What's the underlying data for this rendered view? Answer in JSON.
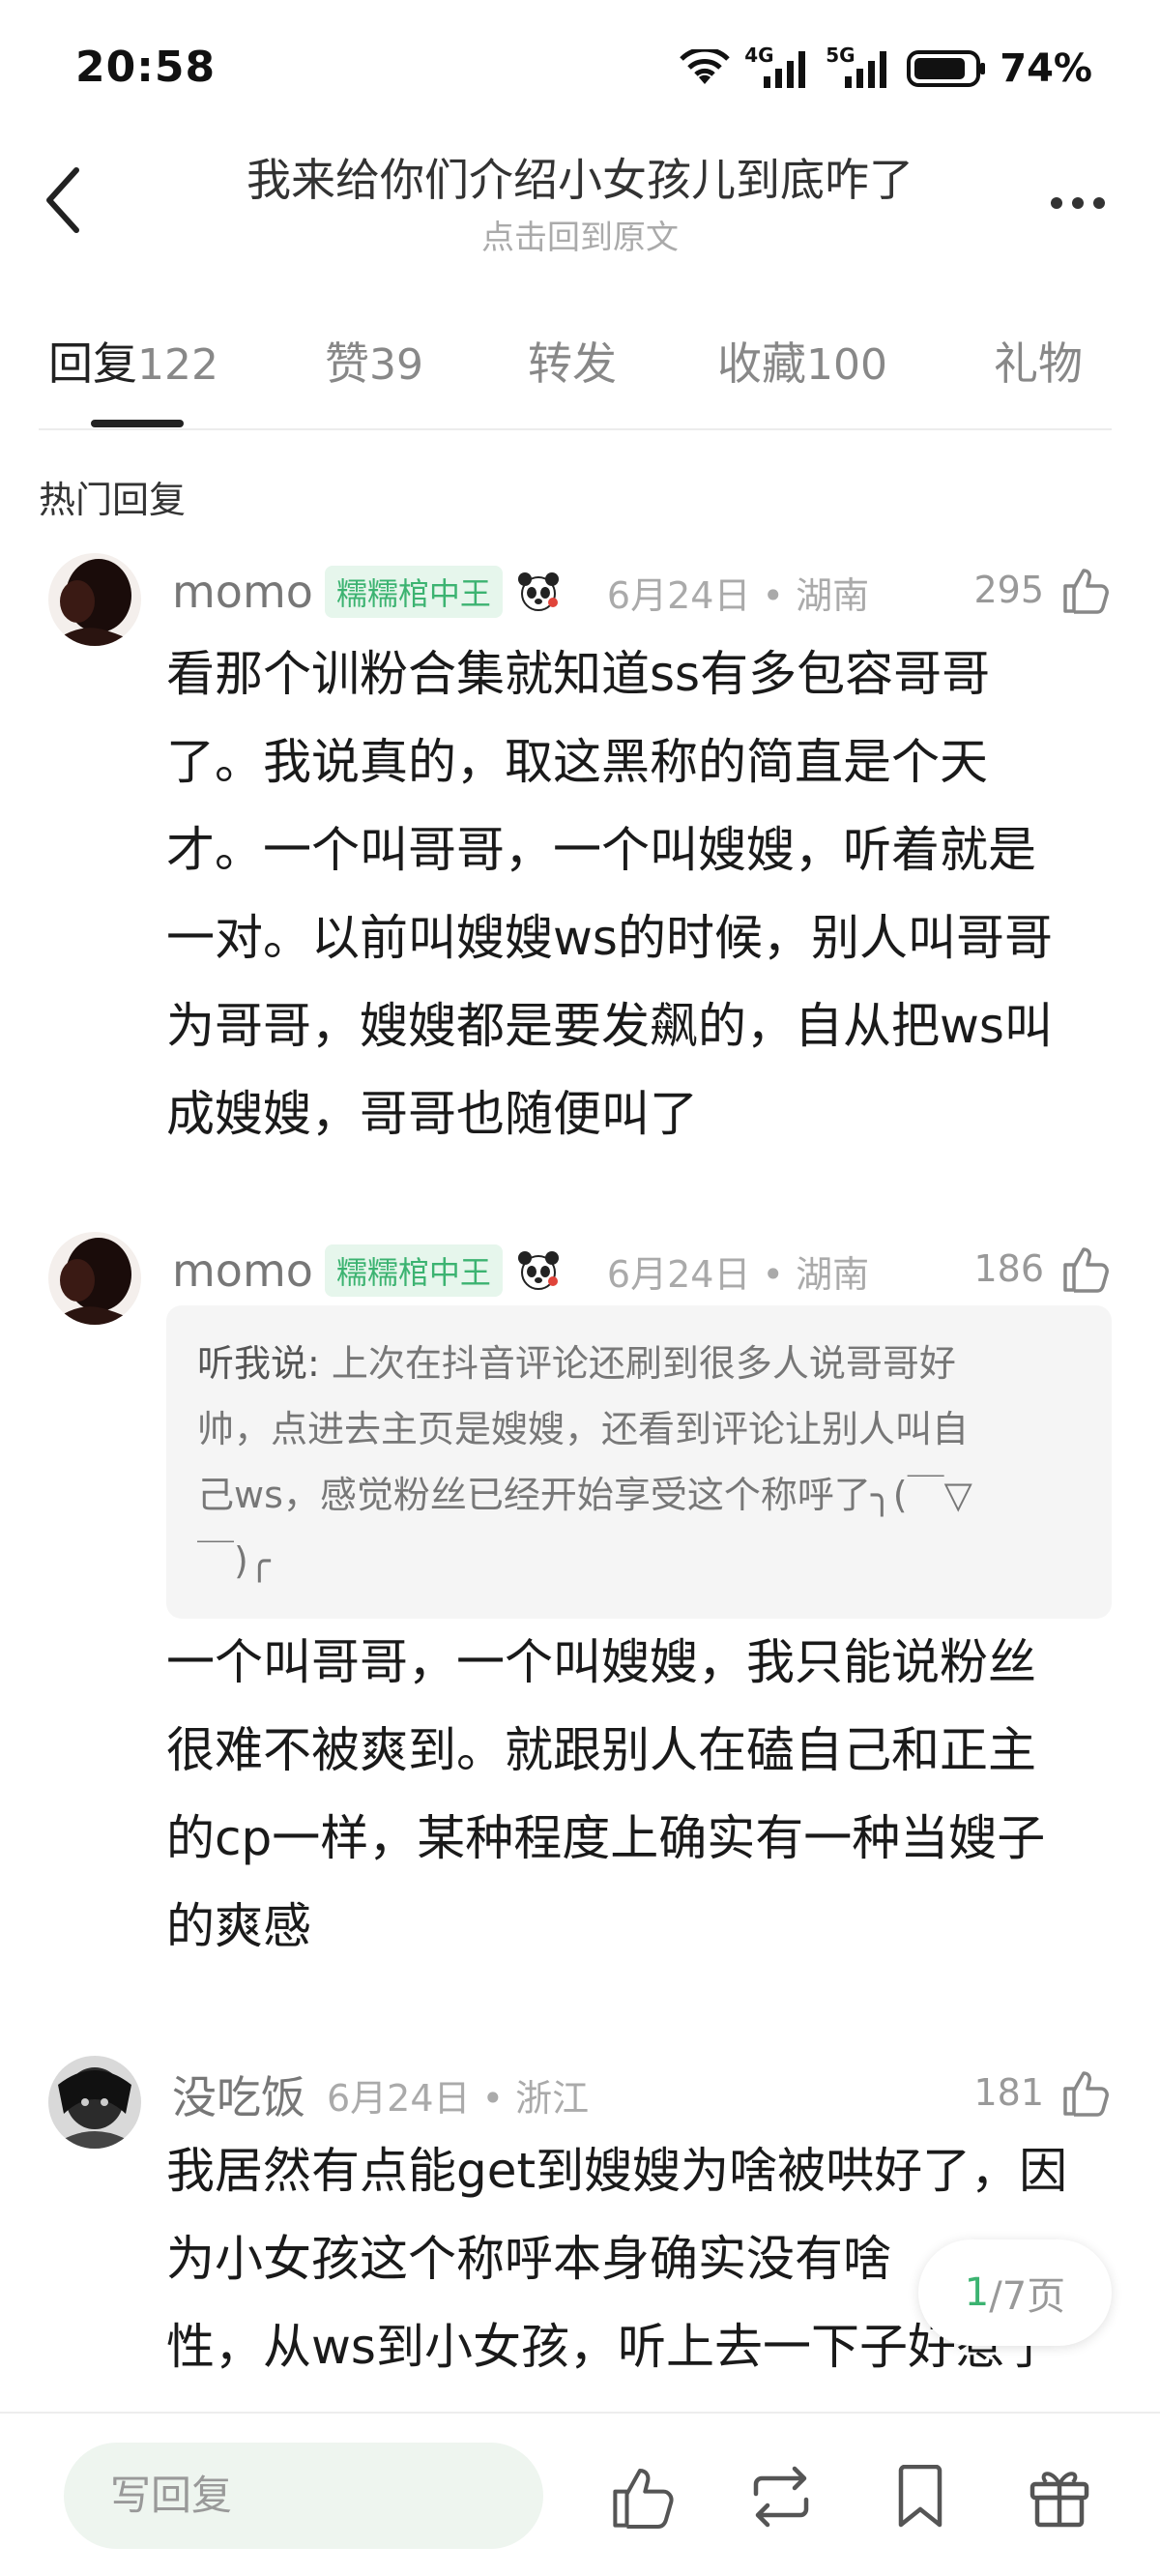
{
  "status_bar": {
    "time": "20:58",
    "net1": "4G",
    "net2": "5G",
    "battery": "74%"
  },
  "header": {
    "title": "我来给你们介绍小女孩儿到底咋了",
    "subtitle": "点击回到原文"
  },
  "tabs": [
    {
      "label": "回复",
      "count": "122"
    },
    {
      "label": "赞",
      "count": "39"
    },
    {
      "label": "转发",
      "count": ""
    },
    {
      "label": "收藏",
      "count": "100"
    },
    {
      "label": "礼物",
      "count": ""
    }
  ],
  "section_label": "热门回复",
  "posts": [
    {
      "username": "momo",
      "badge": "糯糯棺中王",
      "date": "6月24日",
      "sep": "•",
      "location": "湖南",
      "likes": "295",
      "lines": [
        "看那个训粉合集就知道ss有多包容哥哥",
        "了。我说真的，取这黑称的简直是个天",
        "才。一个叫哥哥，一个叫嫂嫂，听着就是",
        "一对。以前叫嫂嫂ws的时候，别人叫哥哥",
        "为哥哥，嫂嫂都是要发飙的，自从把ws叫",
        "成嫂嫂，哥哥也随便叫了"
      ]
    },
    {
      "username": "momo",
      "badge": "糯糯棺中王",
      "date": "6月24日",
      "sep": "•",
      "location": "湖南",
      "likes": "186",
      "quote_author": "听我说:",
      "quote_lines": [
        " 上次在抖音评论还刷到很多人说哥哥好",
        "帅，点进去主页是嫂嫂，还看到评论让别人叫自",
        "己ws，感觉粉丝已经开始享受这个称呼了╮(￣▽",
        "￣)╭"
      ],
      "lines": [
        "一个叫哥哥，一个叫嫂嫂，我只能说粉丝",
        "很难不被爽到。就跟别人在磕自己和正主",
        "的cp一样，某种程度上确实有一种当嫂子",
        "的爽感"
      ]
    },
    {
      "username": "没吃饭",
      "date": "6月24日",
      "sep": "•",
      "location": "浙江",
      "likes": "181",
      "lines": [
        "我居然有点能get到嫂嫂为啥被哄好了，因",
        "为小女孩这个称呼本身确实没有啥",
        "性，从ws到小女孩，听上去一下子好惹了"
      ]
    }
  ],
  "page_indicator": {
    "current": "1",
    "total": "/7页"
  },
  "bottom_bar": {
    "reply_placeholder": "写回复"
  },
  "colors": {
    "accent": "#3cb371",
    "badge_bg": "#e6f6ec",
    "text": "#1a1a1a",
    "muted": "#aaaaaa"
  }
}
